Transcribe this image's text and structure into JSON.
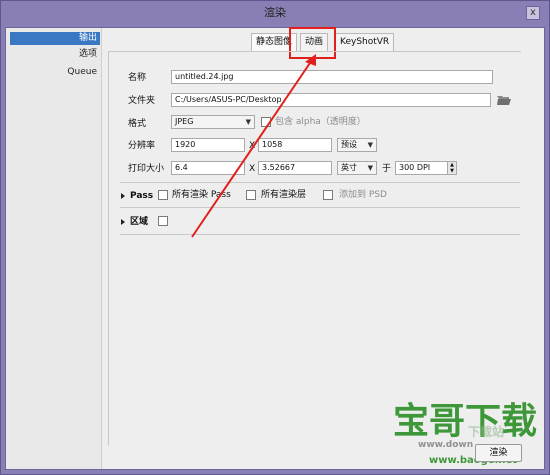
{
  "window": {
    "title": "渲染",
    "close_label": "x"
  },
  "sidebar": {
    "items": [
      {
        "label": "输出"
      },
      {
        "label": "选项"
      },
      {
        "label": "Queue"
      }
    ]
  },
  "tabs": [
    {
      "label": "静态图像"
    },
    {
      "label": "动画"
    },
    {
      "label": "KeyShotVR"
    }
  ],
  "form": {
    "name_label": "名称",
    "name_value": "untitled.24.jpg",
    "folder_label": "文件夹",
    "folder_value": "C:/Users/ASUS-PC/Desktop",
    "format_label": "格式",
    "format_value": "JPEG",
    "alpha_label": "包含 alpha（透明度）",
    "resolution_label": "分辨率",
    "res_width": "1920",
    "res_x": "X",
    "res_height": "1058",
    "preset_value": "预设",
    "print_label": "打印大小",
    "print_width": "6.4",
    "print_x": "X",
    "print_height": "3.52667",
    "unit_value": "英寸",
    "at_label": "于",
    "dpi_value": "300 DPI"
  },
  "pass_section": {
    "label": "Pass",
    "all_render_pass": "所有渲染 Pass",
    "all_render_layers": "所有渲染层",
    "add_to_psd": "添加到 PSD"
  },
  "region_section": {
    "label": "区域"
  },
  "footer": {
    "render_button": "渲染"
  },
  "watermark": {
    "brand": "宝哥下载",
    "sub": "www.baoge.net",
    "partial": "下载站",
    "overlay": "www.down"
  },
  "colors": {
    "accent_red": "#e0201c",
    "selection_blue": "#3a78c4",
    "window_frame": "#8a7fb4"
  }
}
